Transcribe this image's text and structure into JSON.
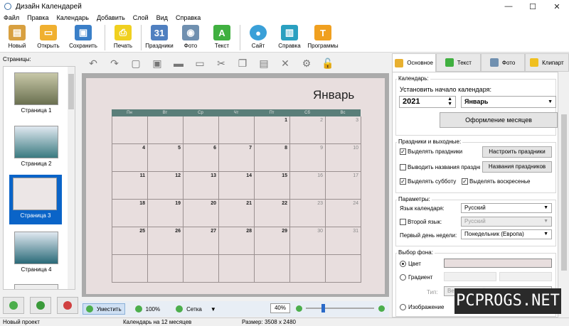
{
  "window": {
    "title": "Дизайн Календарей",
    "controls": [
      "—",
      "☐",
      "✕"
    ]
  },
  "menu": [
    "Файл",
    "Правка",
    "Календарь",
    "Добавить",
    "Слой",
    "Вид",
    "Справка"
  ],
  "toolbar": [
    {
      "label": "Новый",
      "color": "#d8a040"
    },
    {
      "label": "Открыть",
      "color": "#f0b030"
    },
    {
      "label": "Сохранить",
      "color": "#3a7fc8"
    },
    {
      "label": "Печать",
      "color": "#f0d020"
    },
    {
      "label": "Праздники",
      "color": "#5080c0"
    },
    {
      "label": "Фото",
      "color": "#7090b0"
    },
    {
      "label": "Текст",
      "color": "#40b040"
    },
    {
      "label": "Сайт",
      "color": "#3aa0d8"
    },
    {
      "label": "Справка",
      "color": "#2aa0c0"
    },
    {
      "label": "Программы",
      "color": "#f0a020"
    }
  ],
  "left": {
    "pages_label": "Страницы:",
    "pages": [
      {
        "label": "Страница 1",
        "color": "#8a8f6a"
      },
      {
        "label": "Страница 2",
        "color": "#5a8aa0"
      },
      {
        "label": "Страница 3",
        "color": "#e8e4e4"
      },
      {
        "label": "Страница 4",
        "color": "#4a7a90"
      }
    ]
  },
  "calendar": {
    "month": "Январь",
    "weekdays": [
      "Пн",
      "Вт",
      "Ср",
      "Чт",
      "Пт",
      "Сб",
      "Вс"
    ],
    "rows": [
      [
        "",
        "",
        "",
        "",
        "1",
        "2",
        "3"
      ],
      [
        "4",
        "5",
        "6",
        "7",
        "8",
        "9",
        "10"
      ],
      [
        "11",
        "12",
        "13",
        "14",
        "15",
        "16",
        "17"
      ],
      [
        "18",
        "19",
        "20",
        "21",
        "22",
        "23",
        "24"
      ],
      [
        "25",
        "26",
        "27",
        "28",
        "29",
        "30",
        "31"
      ],
      [
        "",
        "",
        "",
        "",
        "",
        "",
        ""
      ]
    ]
  },
  "zoombar": {
    "fit": "Уместить",
    "hundred": "100%",
    "grid": "Сетка",
    "zoom": "40%",
    "zoom_level": 0.4
  },
  "status": {
    "project": "Новый проект",
    "calendar": "Календарь на 12 месяцев",
    "size": "Размер: 3508 x 2480"
  },
  "right": {
    "tabs": [
      "Основное",
      "Текст",
      "Фото",
      "Клипарт"
    ],
    "calendar_group": "Календарь:",
    "start_label": "Установить начало календаря:",
    "year": "2021",
    "month": "Январь",
    "months_design": "Оформление месяцев",
    "holidays_group": "Праздники и выходные:",
    "highlight_holidays": "Выделять праздники",
    "setup_holidays": "Настроить праздники",
    "show_names": "Выводить названия праздников",
    "holiday_names": "Названия праздников",
    "highlight_sat": "Выделять субботу",
    "highlight_sun": "Выделять воскресенье",
    "params_group": "Параметры:",
    "lang_label": "Язык календаря:",
    "lang_value": "Русский",
    "second_lang": "Второй язык:",
    "second_lang_value": "Русский",
    "first_day_label": "Первый день недели:",
    "first_day_value": "Понедельник (Европа)",
    "bg_group": "Выбор фона:",
    "color": "Цвет",
    "gradient": "Градиент",
    "type_label": "Тип:",
    "type_value": "Вертикальный",
    "image": "Изображение"
  },
  "watermark": "PCPROGS.NET"
}
